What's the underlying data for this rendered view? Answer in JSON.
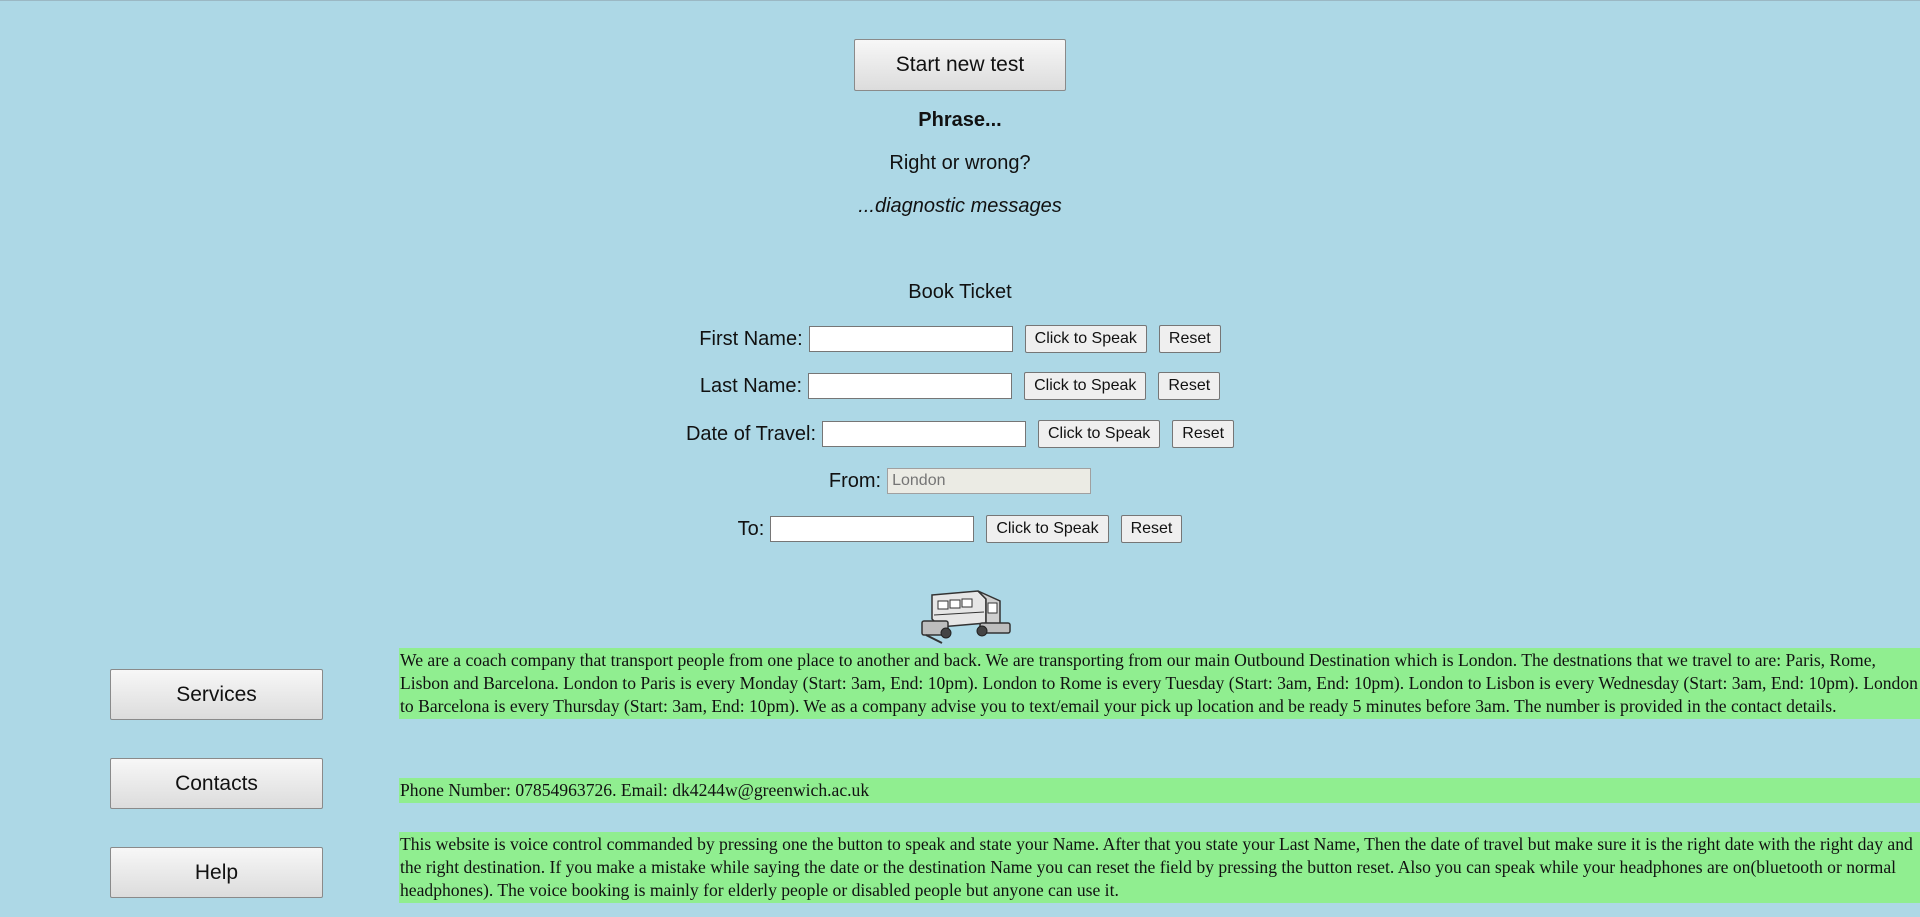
{
  "test": {
    "start_label": "Start new test",
    "phrase": "Phrase...",
    "right_wrong": "Right or wrong?",
    "diagnostic": "...diagnostic messages"
  },
  "booking": {
    "title": "Book Ticket",
    "speak_label": "Click to Speak",
    "reset_label": "Reset",
    "first_name_label": "First Name:",
    "last_name_label": "Last Name:",
    "date_label": "Date of Travel:",
    "from_label": "From:",
    "from_placeholder": "London",
    "to_label": "To:"
  },
  "icons": {
    "coach": "coach-icon"
  },
  "nav": {
    "services": "Services",
    "contacts": "Contacts",
    "help": "Help"
  },
  "info": {
    "about": "We are a coach company that transport people from one place to another and back. We are transporting from our main Outbound Destination which is London. The destnations that we travel to are: Paris, Rome, Lisbon and Barcelona. London to Paris is every Monday (Start: 3am, End: 10pm). London to Rome is every Tuesday (Start: 3am, End: 10pm). London to Lisbon is every Wednesday (Start: 3am, End: 10pm). London to Barcelona is every Thursday (Start: 3am, End: 10pm). We as a company advise you to text/email your pick up location and be ready 5 minutes before 3am. The number is provided in the contact details.",
    "contact": "Phone Number: 07854963726. Email: dk4244w@greenwich.ac.uk",
    "help": "This website is voice control commanded by pressing one the button to speak and state your Name. After that you state your Last Name, Then the date of travel but make sure it is the right date with the right day and the right destination. If you make a mistake while saying the date or the destination Name you can reset the field by pressing the button reset. Also you can speak while your headphones are on(bluetooth or normal headphones). The voice booking is mainly for elderly people or disabled people but anyone can use it."
  },
  "colors": {
    "background": "#add8e6",
    "info_highlight": "#90ee90"
  }
}
